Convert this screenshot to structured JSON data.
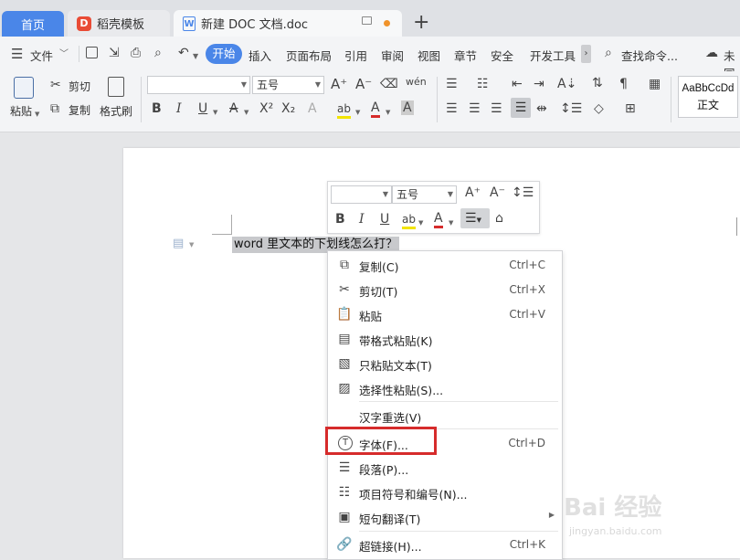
{
  "tabs": {
    "home": "首页",
    "templates": "稻壳模板",
    "doc": "新建 DOC 文档.doc"
  },
  "menu": {
    "file": "文件",
    "items": [
      "开始",
      "插入",
      "页面布局",
      "引用",
      "审阅",
      "视图",
      "章节",
      "安全",
      "开发工具"
    ],
    "search": "查找命令...",
    "cloud": "未同"
  },
  "ribbon": {
    "paste": "粘贴",
    "cut": "剪切",
    "copy": "复制",
    "format_painter": "格式刷",
    "font_size": "五号",
    "style_sample": "AaBbCcDd",
    "style_name": "正文"
  },
  "document": {
    "selected_text": "word 里文本的下划线怎么打？"
  },
  "mini_toolbar": {
    "font_size": "五号"
  },
  "context_menu": [
    {
      "label": "复制(C)",
      "shortcut": "Ctrl+C",
      "icon": "copy-icon"
    },
    {
      "label": "剪切(T)",
      "shortcut": "Ctrl+X",
      "icon": "cut-icon"
    },
    {
      "label": "粘贴",
      "shortcut": "Ctrl+V",
      "icon": "paste-icon"
    },
    {
      "label": "带格式粘贴(K)",
      "shortcut": "",
      "icon": "paste-format-icon"
    },
    {
      "label": "只粘贴文本(T)",
      "shortcut": "",
      "icon": "paste-text-icon"
    },
    {
      "label": "选择性粘贴(S)...",
      "shortcut": "",
      "icon": "paste-special-icon"
    },
    {
      "label": "汉字重选(V)",
      "shortcut": "",
      "icon": ""
    },
    {
      "label": "字体(F)...",
      "shortcut": "Ctrl+D",
      "icon": "font-icon"
    },
    {
      "label": "段落(P)...",
      "shortcut": "",
      "icon": "paragraph-icon"
    },
    {
      "label": "项目符号和编号(N)...",
      "shortcut": "",
      "icon": "list-icon"
    },
    {
      "label": "短句翻译(T)",
      "shortcut": "",
      "icon": "translate-icon"
    },
    {
      "label": "超链接(H)...",
      "shortcut": "Ctrl+K",
      "icon": "link-icon"
    }
  ],
  "watermark": {
    "brand": "Bai 经验",
    "url": "jingyan.baidu.com"
  },
  "colors": {
    "accent": "#4a86e8",
    "highlight": "#d62b2b",
    "selection": "#c8c9cc"
  }
}
